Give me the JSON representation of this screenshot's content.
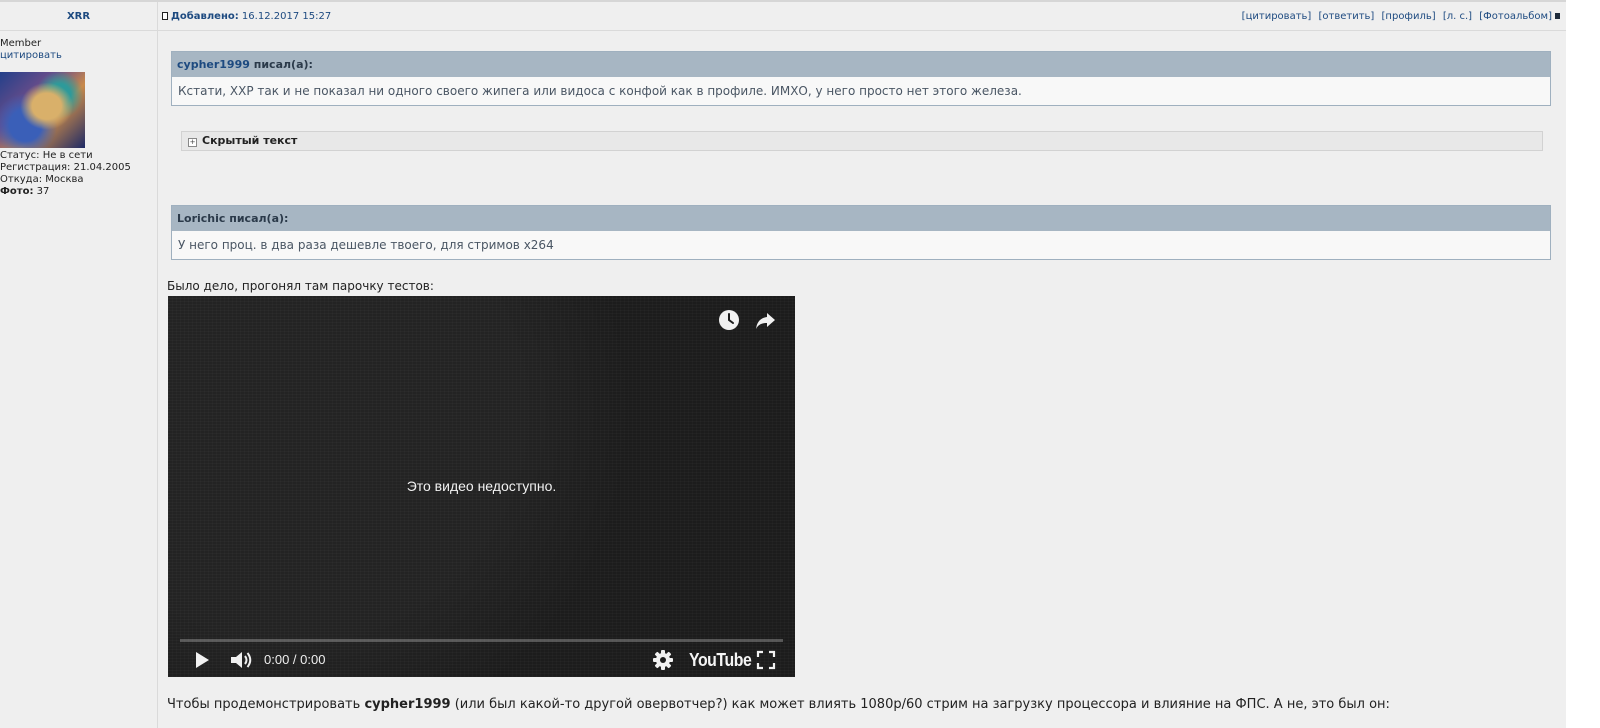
{
  "post": {
    "author": "XRR",
    "added_label": "Добавлено:",
    "added_datetime": "16.12.2017 15:27",
    "actions": [
      "[цитировать]",
      "[ответить]",
      "[профиль]",
      "[л. с.]",
      "[Фотоальбом]"
    ]
  },
  "user": {
    "rank": "Member",
    "quote_link": "цитировать",
    "status": "Статус: Не в сети",
    "registration": "Регистрация: 21.04.2005",
    "from": "Откуда: Москва",
    "photo_label": "Фото:",
    "photo_count": "37"
  },
  "quotes": [
    {
      "author": "cypher1999",
      "suffix": "писал(а):",
      "text": "Кстати, XXP так и не показал ни одного своего жипега или видоса с конфой как в профиле. ИМХО, у него просто нет этого железа."
    },
    {
      "author": "Lorichic",
      "suffix": "писал(а):",
      "text": "У него проц. в два раза дешевле твоего, для стримов x264"
    }
  ],
  "spoiler": {
    "label": "Скрытый текст"
  },
  "body": {
    "intro": "Было дело, прогонял там парочку тестов:",
    "closing_pre": "Чтобы продемонстрировать ",
    "closing_bold": "cypher1999",
    "closing_post": " (или был какой-то другой овервотчер?) как может влиять 1080р/60 стрим на загрузку процессора и влияние на ФПС. А не, это был он:"
  },
  "video": {
    "message": "Это видео недоступно.",
    "time": "0:00 / 0:00",
    "logo": "YouTube",
    "icons": [
      "watch-later-icon",
      "share-icon",
      "play-icon",
      "volume-icon",
      "settings-icon",
      "fullscreen-icon"
    ]
  },
  "colors": {
    "link": "#1d4a80",
    "quote_header": "#a7b6c3",
    "page_bg": "#efefef"
  }
}
